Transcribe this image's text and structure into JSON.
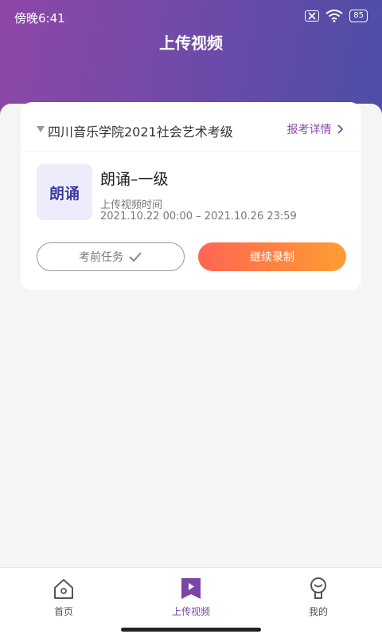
{
  "status": {
    "time": "傍晚6:41",
    "battery": "85"
  },
  "page": {
    "title": "上传视频"
  },
  "exam": {
    "school": "四川音乐学院2021社会艺术考级",
    "detail_label": "报考详情",
    "thumb_text": "朗诵",
    "course_title": "朗诵–一级",
    "upload_label": "上传视频时间",
    "upload_range": "2021.10.22 00:00 – 2021.10.26 23:59",
    "pre_exam_button": "考前任务",
    "continue_button": "继续录制"
  },
  "tabs": [
    {
      "label": "首页",
      "icon": "home-icon"
    },
    {
      "label": "上传视频",
      "icon": "video-upload-icon",
      "active": true
    },
    {
      "label": "我的",
      "icon": "profile-icon"
    }
  ],
  "colors": {
    "accent": "#7a45a5",
    "button_gradient_start": "#ff6653",
    "button_gradient_end": "#ff9d33"
  }
}
